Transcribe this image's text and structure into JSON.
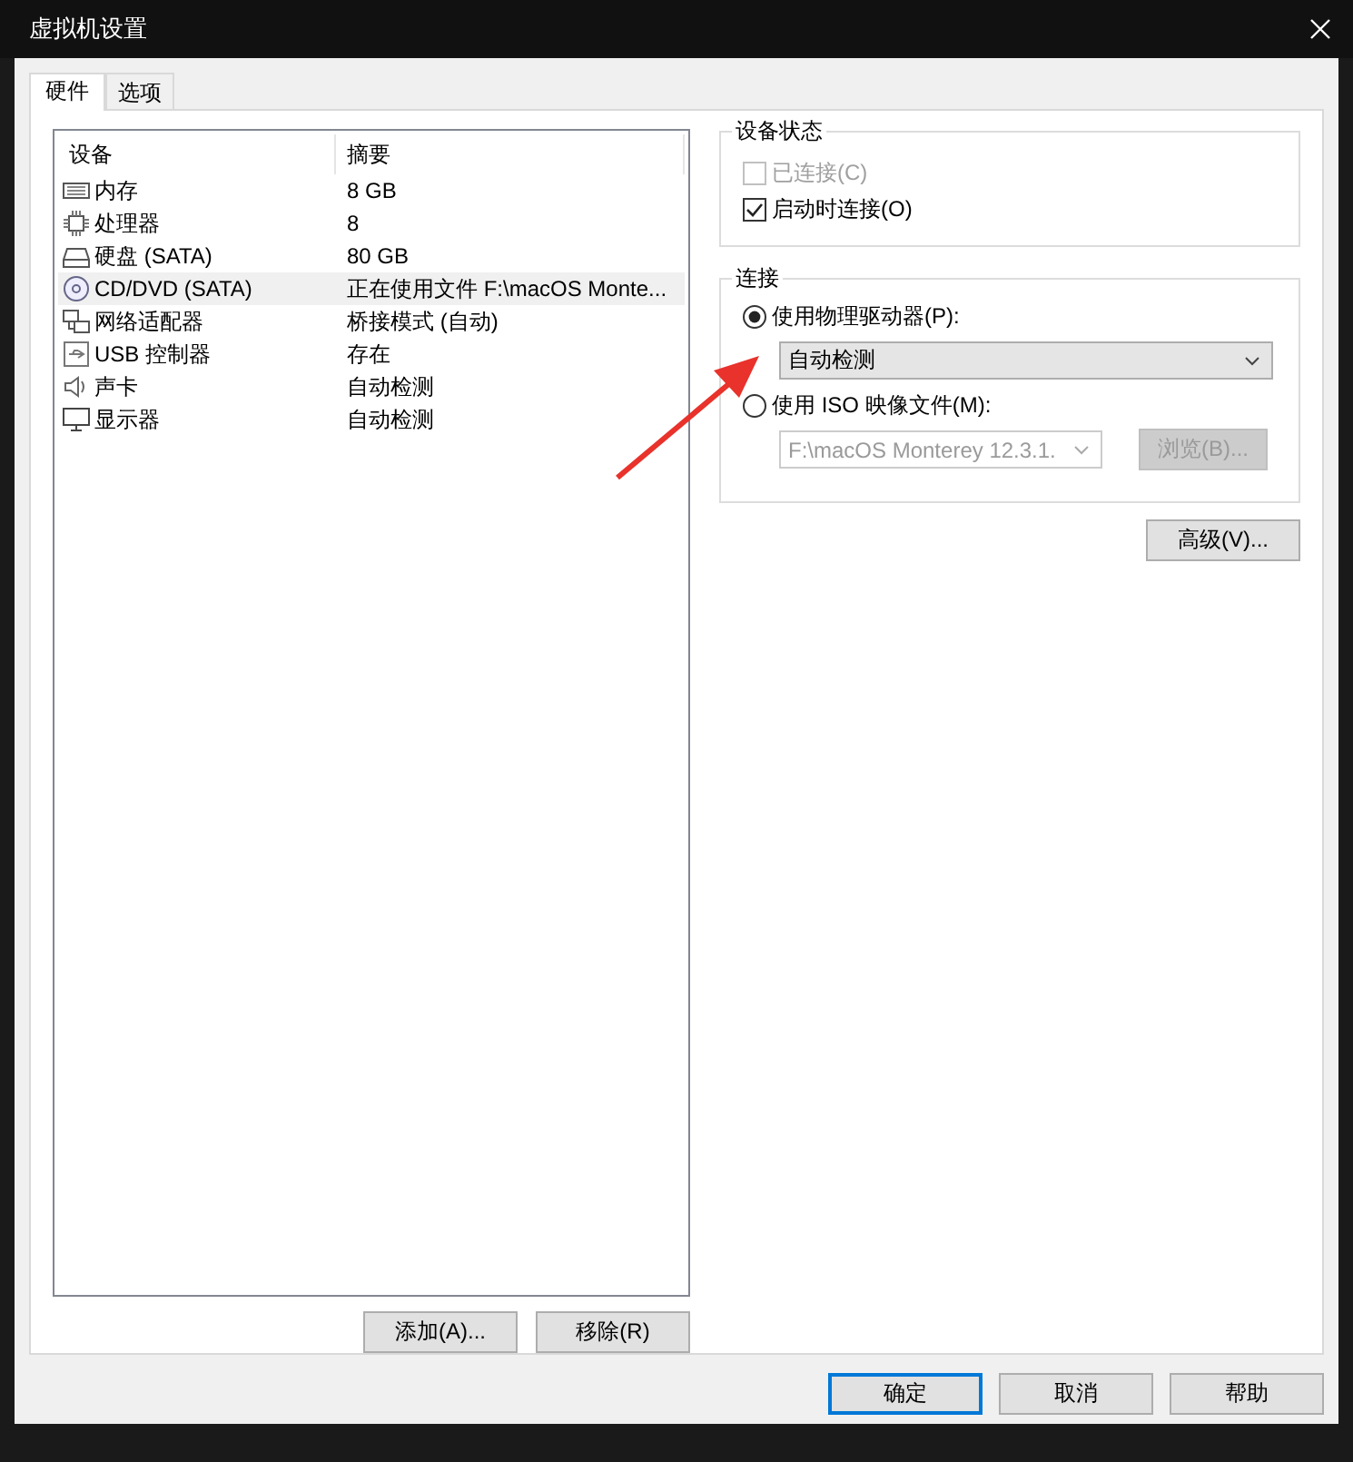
{
  "window": {
    "title": "虚拟机设置"
  },
  "tabs": [
    {
      "label": "硬件",
      "selected": true
    },
    {
      "label": "选项",
      "selected": false
    }
  ],
  "device_table": {
    "columns": [
      "设备",
      "摘要"
    ],
    "rows": [
      {
        "kind": "memory",
        "device": "内存",
        "summary": "8 GB",
        "selected": false
      },
      {
        "kind": "cpu",
        "device": "处理器",
        "summary": "8",
        "selected": false
      },
      {
        "kind": "disk",
        "device": "硬盘 (SATA)",
        "summary": "80 GB",
        "selected": false
      },
      {
        "kind": "cd",
        "device": "CD/DVD (SATA)",
        "summary": "正在使用文件 F:\\macOS Monte...",
        "selected": true
      },
      {
        "kind": "network",
        "device": "网络适配器",
        "summary": "桥接模式 (自动)",
        "selected": false
      },
      {
        "kind": "usb",
        "device": "USB 控制器",
        "summary": "存在",
        "selected": false
      },
      {
        "kind": "sound",
        "device": "声卡",
        "summary": "自动检测",
        "selected": false
      },
      {
        "kind": "display",
        "device": "显示器",
        "summary": "自动检测",
        "selected": false
      }
    ]
  },
  "device_buttons": [
    "添加(A)...",
    "移除(R)"
  ],
  "device_status": {
    "title": "设备状态",
    "options": [
      {
        "label": "已连接(C)",
        "checked": false,
        "disabled": true
      },
      {
        "label": "启动时连接(O)",
        "checked": true,
        "disabled": false
      }
    ]
  },
  "connection": {
    "title": "连接",
    "options": [
      {
        "label": "使用物理驱动器(P):",
        "selected": true,
        "dropdown": {
          "value": "自动检测",
          "disabled": false
        }
      },
      {
        "label": "使用 ISO 映像文件(M):",
        "selected": false,
        "dropdown": {
          "value": "F:\\macOS Monterey 12.3.1.",
          "disabled": true
        },
        "browse": {
          "label": "浏览(B)...",
          "disabled": true
        }
      }
    ]
  },
  "advanced_button": "高级(V)...",
  "footer_buttons": [
    {
      "label": "确定",
      "default": true
    },
    {
      "label": "取消",
      "default": false
    },
    {
      "label": "帮助",
      "default": false
    }
  ]
}
